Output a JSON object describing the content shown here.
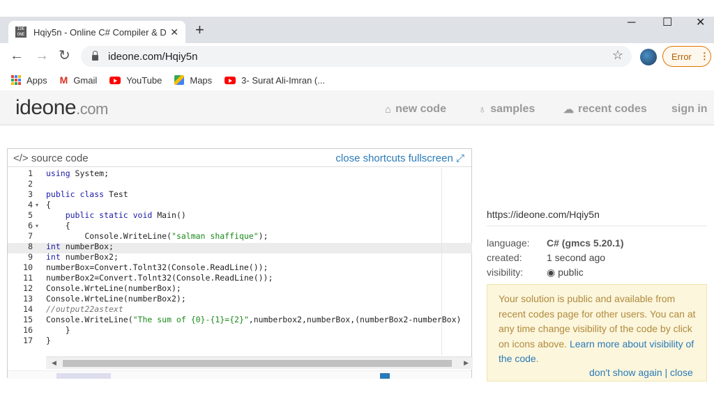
{
  "browser": {
    "tab_title": "Hqiy5n - Online C# Compiler & D",
    "favicon_text": "IDE ONE",
    "url": "ideone.com/Hqiy5n",
    "error_label": "Error"
  },
  "bookmarks": [
    {
      "label": "Apps",
      "icon": "apps-grid-icon"
    },
    {
      "label": "Gmail",
      "icon": "gmail-icon"
    },
    {
      "label": "YouTube",
      "icon": "youtube-icon"
    },
    {
      "label": "Maps",
      "icon": "maps-icon"
    },
    {
      "label": "3- Surat Ali-Imran (...",
      "icon": "youtube-icon"
    }
  ],
  "site": {
    "logo_main": "ideone",
    "logo_suffix": ".com",
    "nav": [
      {
        "label": "new code",
        "icon": "home-icon"
      },
      {
        "label": "samples",
        "icon": "bulb-icon"
      },
      {
        "label": "recent codes",
        "icon": "cloud-icon"
      },
      {
        "label": "sign in",
        "icon": ""
      }
    ]
  },
  "editor": {
    "title": "source code",
    "links": "close shortcuts fullscreen",
    "lines": [
      {
        "n": "1",
        "fold": "",
        "tokens": [
          {
            "t": "kw",
            "v": "using"
          },
          {
            "t": "",
            "v": " System;"
          }
        ]
      },
      {
        "n": "2",
        "fold": "",
        "tokens": []
      },
      {
        "n": "3",
        "fold": "",
        "tokens": [
          {
            "t": "kw",
            "v": "public class"
          },
          {
            "t": "",
            "v": " Test"
          }
        ]
      },
      {
        "n": "4",
        "fold": "▾",
        "tokens": [
          {
            "t": "",
            "v": "{"
          }
        ]
      },
      {
        "n": "5",
        "fold": "",
        "tokens": [
          {
            "t": "",
            "v": "    "
          },
          {
            "t": "kw",
            "v": "public static void"
          },
          {
            "t": "",
            "v": " Main()"
          }
        ]
      },
      {
        "n": "6",
        "fold": "▾",
        "tokens": [
          {
            "t": "",
            "v": "    {"
          }
        ]
      },
      {
        "n": "7",
        "fold": "",
        "tokens": [
          {
            "t": "",
            "v": "        Console.WriteLine("
          },
          {
            "t": "str",
            "v": "\"salman shaffique\""
          },
          {
            "t": "",
            "v": ");"
          }
        ]
      },
      {
        "n": "8",
        "fold": "",
        "tokens": [
          {
            "t": "kw",
            "v": "int"
          },
          {
            "t": "",
            "v": " numberBox;"
          }
        ]
      },
      {
        "n": "9",
        "fold": "",
        "tokens": [
          {
            "t": "kw",
            "v": "int"
          },
          {
            "t": "",
            "v": " numberBox2;"
          }
        ]
      },
      {
        "n": "10",
        "fold": "",
        "tokens": [
          {
            "t": "",
            "v": "numberBox=Convert.Tolnt32(Console.ReadLine());"
          }
        ]
      },
      {
        "n": "11",
        "fold": "",
        "tokens": [
          {
            "t": "",
            "v": "numberBox2=Convert.Tolnt32(Console.ReadLine());"
          }
        ]
      },
      {
        "n": "12",
        "fold": "",
        "tokens": [
          {
            "t": "",
            "v": "Console.WrteLine(numberBox);"
          }
        ]
      },
      {
        "n": "13",
        "fold": "",
        "tokens": [
          {
            "t": "",
            "v": "Console.WrteLine(numberBox2);"
          }
        ]
      },
      {
        "n": "14",
        "fold": "",
        "tokens": [
          {
            "t": "cm",
            "v": "//output22astext"
          }
        ]
      },
      {
        "n": "15",
        "fold": "",
        "tokens": [
          {
            "t": "",
            "v": "Console.WriteLine("
          },
          {
            "t": "str",
            "v": "\"The sum of {0}-{1}={2}\""
          },
          {
            "t": "",
            "v": ",numberbox2,numberBox,(numberBox2-numberBox)"
          }
        ]
      },
      {
        "n": "16",
        "fold": "",
        "tokens": [
          {
            "t": "",
            "v": "    }"
          }
        ]
      },
      {
        "n": "17",
        "fold": "",
        "tokens": [
          {
            "t": "",
            "v": "}"
          }
        ]
      }
    ]
  },
  "info": {
    "url": "https://ideone.com/Hqiy5n",
    "language_label": "language:",
    "language_value": "C# (gmcs 5.20.1)",
    "created_label": "created:",
    "created_value": "1 second ago",
    "visibility_label": "visibility:",
    "visibility_value": "public"
  },
  "notice": {
    "text": "Your solution is public and available from recent codes page for other users. You can at any time change visibility of the code by click on icons above. ",
    "link1": "Learn more about visibility of the code",
    "after_link": ".",
    "footer": "don't show again | close"
  }
}
